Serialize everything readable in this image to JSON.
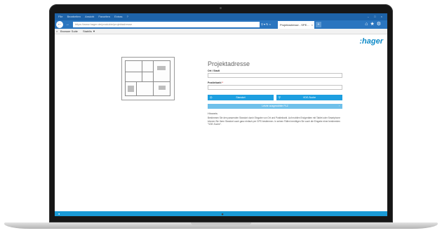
{
  "browser": {
    "menu": [
      "File",
      "Bearbeiten",
      "Ansicht",
      "Favoriten",
      "Extras",
      "?"
    ],
    "address_url": "https://www.hager.de/produkte/projektadresse",
    "tab_title": "Projektadresse - SPE...",
    "favorites": {
      "close": "×",
      "item1": "Browser Suite",
      "item2": "Stabilis ▼"
    }
  },
  "page": {
    "logo": ":hager",
    "heading": "Projektadresse",
    "fields": {
      "ort_label": "Ort / Stadt",
      "plz_label": "Postleitzahl",
      "required_mark": "*"
    },
    "buttons": {
      "search": "Standort",
      "vde": "VDE-Suche",
      "last_used": "Letzte ausgewählte PLZ"
    },
    "hint": {
      "title": "Hinweis",
      "text": "Bestimmen Sie den passenden Standort durch Eingabe von Ort und Postleitzahl. Auf mobilen Endgeräten mit Tablet oder Smartphone können Sie Ihren Standort auch ganz einfach per GPS bestimmen. In seinen Fällen benötigen Sie auch die Eingabe einer bestimmten \"VDE-Suche\"."
    }
  },
  "icons": {
    "back": "back-arrow-icon",
    "home": "home-icon",
    "favorite": "star-icon",
    "settings": "gear-icon"
  },
  "colors": {
    "brand": "#0e8ac8",
    "button": "#1d9fe0",
    "button_light": "#6fc0ea",
    "chrome": "#2a75bf"
  }
}
